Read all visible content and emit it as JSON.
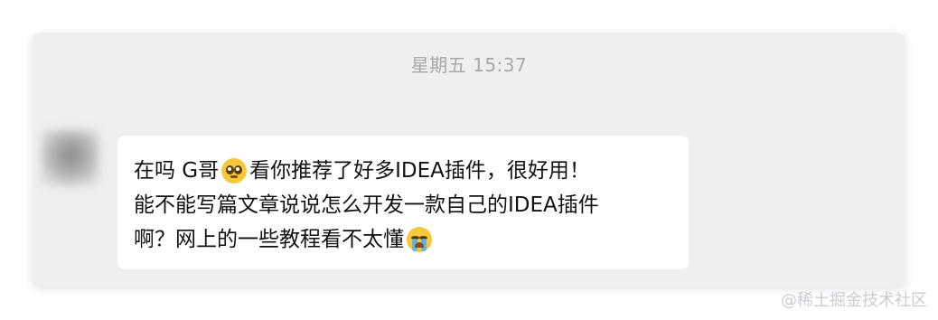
{
  "chat": {
    "timestamp": "星期五 15:37",
    "message": {
      "line1_part1": "在吗  G哥 ",
      "line1_part2": "看你推荐了好多IDEA插件，很好用！",
      "line2": "能不能写篇文章说说怎么开发一款自己的IDEA插件",
      "line3": "啊？网上的一些教程看不太懂 ",
      "emoji1": "pleading-face-icon",
      "emoji2": "loudly-crying-face-icon"
    }
  },
  "watermark": "@稀土掘金技术社区",
  "colors": {
    "window_bg": "#efefef",
    "bubble_bg": "#ffffff",
    "timestamp_text": "#a8a8a8",
    "watermark_text": "#c9cdd4"
  }
}
